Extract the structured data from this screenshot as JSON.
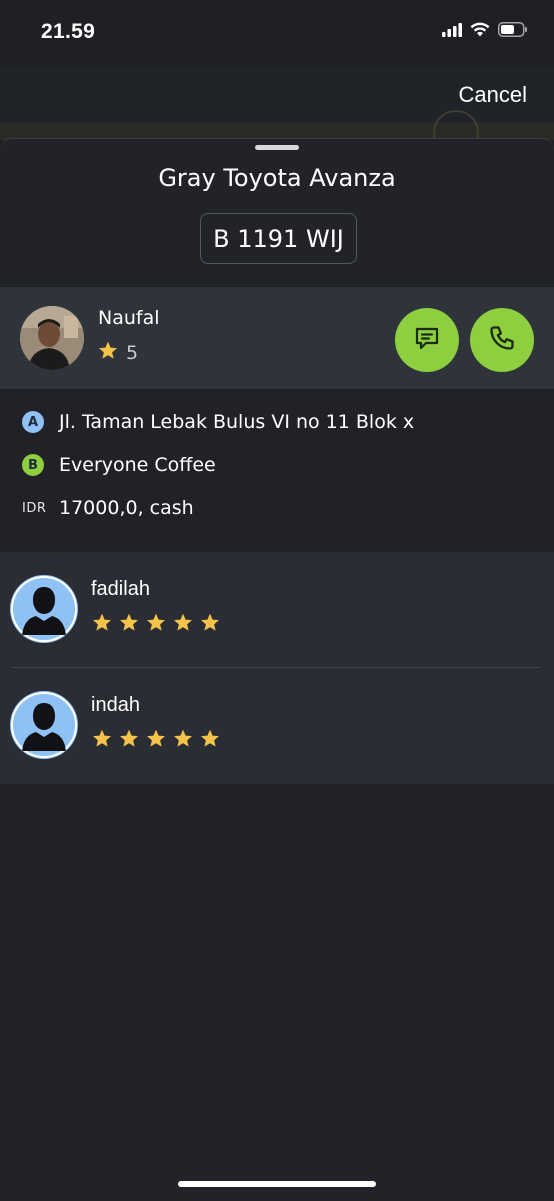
{
  "status": {
    "time": "21.59"
  },
  "header": {
    "cancel_label": "Cancel"
  },
  "vehicle": {
    "title": "Gray Toyota Avanza",
    "plate": "B 1191 WIJ"
  },
  "driver": {
    "name": "Naufal",
    "rating": "5",
    "actions": {
      "chat": "chat-icon",
      "call": "phone-icon"
    }
  },
  "route": {
    "pickup_badge": "A",
    "pickup": "Jl. Taman Lebak Bulus VI no 11 Blok x",
    "dropoff_badge": "B",
    "dropoff": "Everyone Coffee",
    "currency": "IDR",
    "fare": "17000,0, cash"
  },
  "passengers": [
    {
      "name": "fadilah",
      "stars": 5
    },
    {
      "name": "indah",
      "stars": 5
    }
  ],
  "colors": {
    "accent_green": "#8dcf3e",
    "pickup_badge": "#8fc1f5",
    "dropoff_badge": "#8dcf3e",
    "star": "#f5c24a",
    "background": "#1e2025"
  }
}
